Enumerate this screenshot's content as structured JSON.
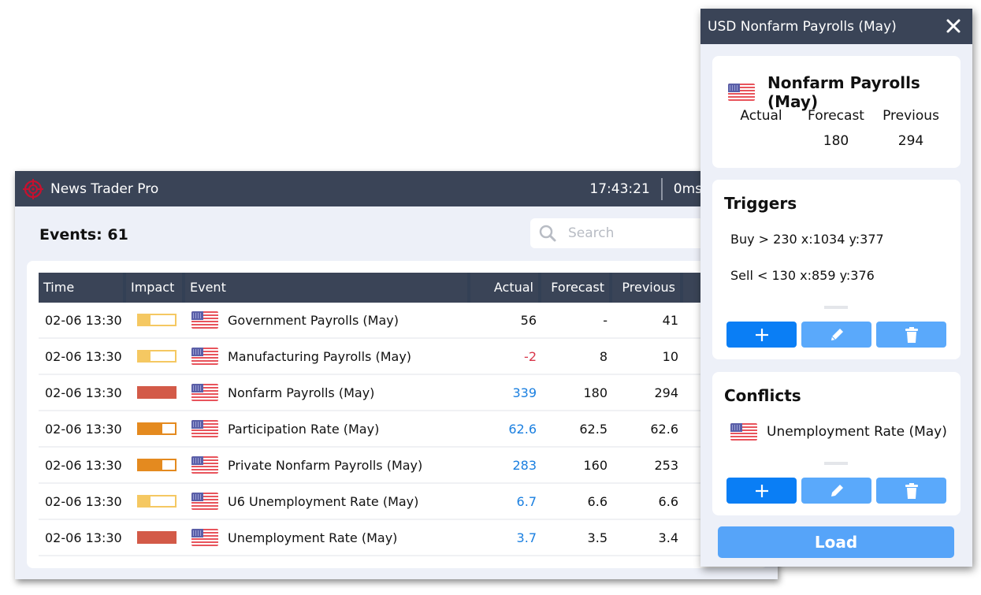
{
  "main_window": {
    "app_title": "News Trader Pro",
    "clock": "17:43:21",
    "latency": "0ms",
    "icons": {
      "logo": "crosshair-target-icon",
      "refresh": "refresh-icon",
      "settings": "gear-icon"
    },
    "events_label": "Events: 61",
    "search": {
      "placeholder": "Search",
      "value": ""
    },
    "table": {
      "columns": [
        "Time",
        "Impact",
        "Event",
        "Actual",
        "Forecast",
        "Previous"
      ],
      "rows": [
        {
          "time": "02-06 13:30",
          "impact": "low",
          "impact_level": 0.33,
          "currency": "USD",
          "event": "Government Payrolls (May)",
          "actual": "56",
          "actual_state": "neutral",
          "forecast": "-",
          "previous": "41"
        },
        {
          "time": "02-06 13:30",
          "impact": "low",
          "impact_level": 0.33,
          "currency": "USD",
          "event": "Manufacturing Payrolls (May)",
          "actual": "-2",
          "actual_state": "negative",
          "forecast": "8",
          "previous": "10"
        },
        {
          "time": "02-06 13:30",
          "impact": "high",
          "impact_level": 1.0,
          "currency": "USD",
          "event": "Nonfarm Payrolls (May)",
          "actual": "339",
          "actual_state": "positive",
          "forecast": "180",
          "previous": "294"
        },
        {
          "time": "02-06 13:30",
          "impact": "medium",
          "impact_level": 0.66,
          "currency": "USD",
          "event": "Participation Rate (May)",
          "actual": "62.6",
          "actual_state": "positive",
          "forecast": "62.5",
          "previous": "62.6"
        },
        {
          "time": "02-06 13:30",
          "impact": "medium",
          "impact_level": 0.66,
          "currency": "USD",
          "event": "Private Nonfarm Payrolls (May)",
          "actual": "283",
          "actual_state": "positive",
          "forecast": "160",
          "previous": "253"
        },
        {
          "time": "02-06 13:30",
          "impact": "low",
          "impact_level": 0.33,
          "currency": "USD",
          "event": "U6 Unemployment Rate (May)",
          "actual": "6.7",
          "actual_state": "positive",
          "forecast": "6.6",
          "previous": "6.6"
        },
        {
          "time": "02-06 13:30",
          "impact": "high",
          "impact_level": 1.0,
          "currency": "USD",
          "event": "Unemployment Rate (May)",
          "actual": "3.7",
          "actual_state": "positive",
          "forecast": "3.5",
          "previous": "3.4"
        }
      ]
    }
  },
  "impact_colors": {
    "low": "#f5c862",
    "medium": "#e48a1f",
    "high": "#d35a48"
  },
  "value_colors": {
    "positive": "#1a7fe0",
    "negative": "#d9364a",
    "neutral": "#111111"
  },
  "detail_window": {
    "title": "USD Nonfarm Payrolls (May)",
    "close_icon": "close-icon",
    "summary": {
      "event": "Nonfarm Payrolls (May)",
      "actual_label": "Actual",
      "forecast_label": "Forecast",
      "previous_label": "Previous",
      "actual": "",
      "forecast": "180",
      "previous": "294"
    },
    "triggers": {
      "title": "Triggers",
      "items": [
        "Buy > 230  x:1034 y:377",
        "Sell < 130  x:859 y:376"
      ]
    },
    "conflicts": {
      "title": "Conflicts",
      "items": [
        "Unemployment Rate (May)"
      ]
    },
    "button_icons": {
      "add": "plus-icon",
      "edit": "pencil-icon",
      "delete": "trash-icon"
    },
    "load_label": "Load"
  }
}
